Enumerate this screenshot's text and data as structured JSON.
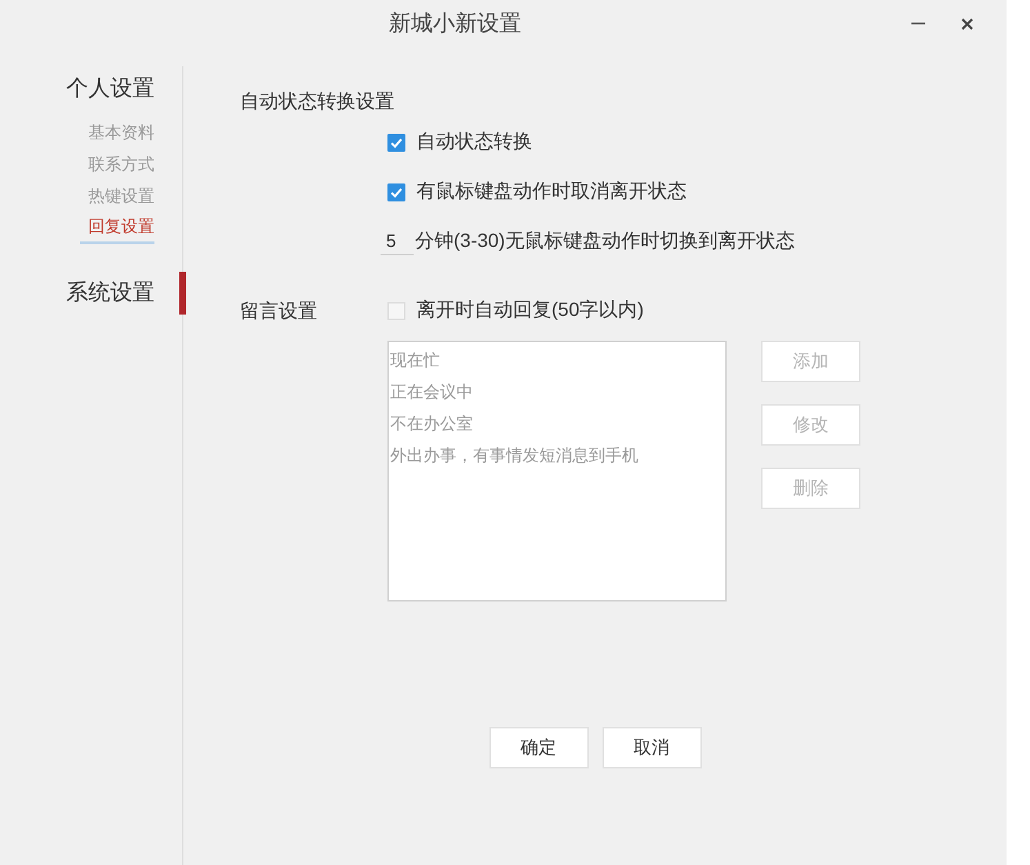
{
  "window": {
    "title": "新城小新设置"
  },
  "sidebar": {
    "sections": [
      {
        "label": "个人设置",
        "selected": false,
        "items": [
          {
            "label": "基本资料",
            "selected": false
          },
          {
            "label": "联系方式",
            "selected": false
          },
          {
            "label": "热键设置",
            "selected": false
          },
          {
            "label": "回复设置",
            "selected": true
          }
        ]
      },
      {
        "label": "系统设置",
        "selected": true
      }
    ]
  },
  "auto_status": {
    "heading": "自动状态转换设置",
    "options": [
      {
        "label": "自动状态转换",
        "checked": true
      },
      {
        "label": "有鼠标键盘动作时取消离开状态",
        "checked": true
      }
    ],
    "minutes": {
      "value": "5",
      "label": "分钟(3-30)无鼠标键盘动作时切换到离开状态"
    }
  },
  "messages": {
    "heading": "留言设置",
    "auto_reply": {
      "label": "离开时自动回复(50字以内)",
      "checked": false
    },
    "list": {
      "disabled": true,
      "items": [
        "现在忙",
        "正在会议中",
        "不在办公室",
        "外出办事，有事情发短消息到手机"
      ]
    },
    "buttons": [
      {
        "label": "添加",
        "disabled": true
      },
      {
        "label": "修改",
        "disabled": true
      },
      {
        "label": "删除",
        "disabled": true
      }
    ]
  },
  "footer_buttons": [
    {
      "label": "确定",
      "disabled": false
    },
    {
      "label": "取消",
      "disabled": false
    }
  ]
}
